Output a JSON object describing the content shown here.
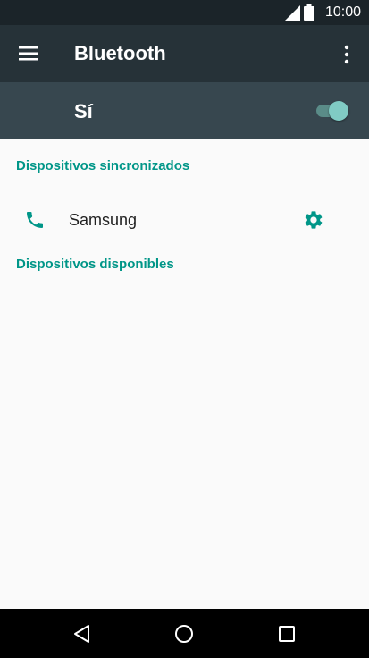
{
  "status_bar": {
    "time": "10:00",
    "icons": [
      "signal-icon",
      "battery-icon"
    ]
  },
  "app_bar": {
    "title": "Bluetooth",
    "icons": [
      "menu-icon",
      "more-vert-icon"
    ],
    "background": "#263238"
  },
  "bluetooth_switch": {
    "label": "Sí",
    "state": "on",
    "background": "#37474f"
  },
  "sections": {
    "paired": {
      "title": "Dispositivos sincronizados",
      "devices": [
        {
          "name": "Samsung",
          "icon": "phone-icon",
          "action_icon": "gear-icon"
        }
      ]
    },
    "available": {
      "title": "Dispositivos disponibles",
      "devices": []
    }
  },
  "nav_bar": {
    "buttons": [
      "back-icon",
      "home-icon",
      "recents-icon"
    ]
  },
  "colors": {
    "accent": "#009688",
    "toggle_thumb": "#80cbc4",
    "toggle_track": "#5a8c88",
    "text_primary": "#212121"
  }
}
